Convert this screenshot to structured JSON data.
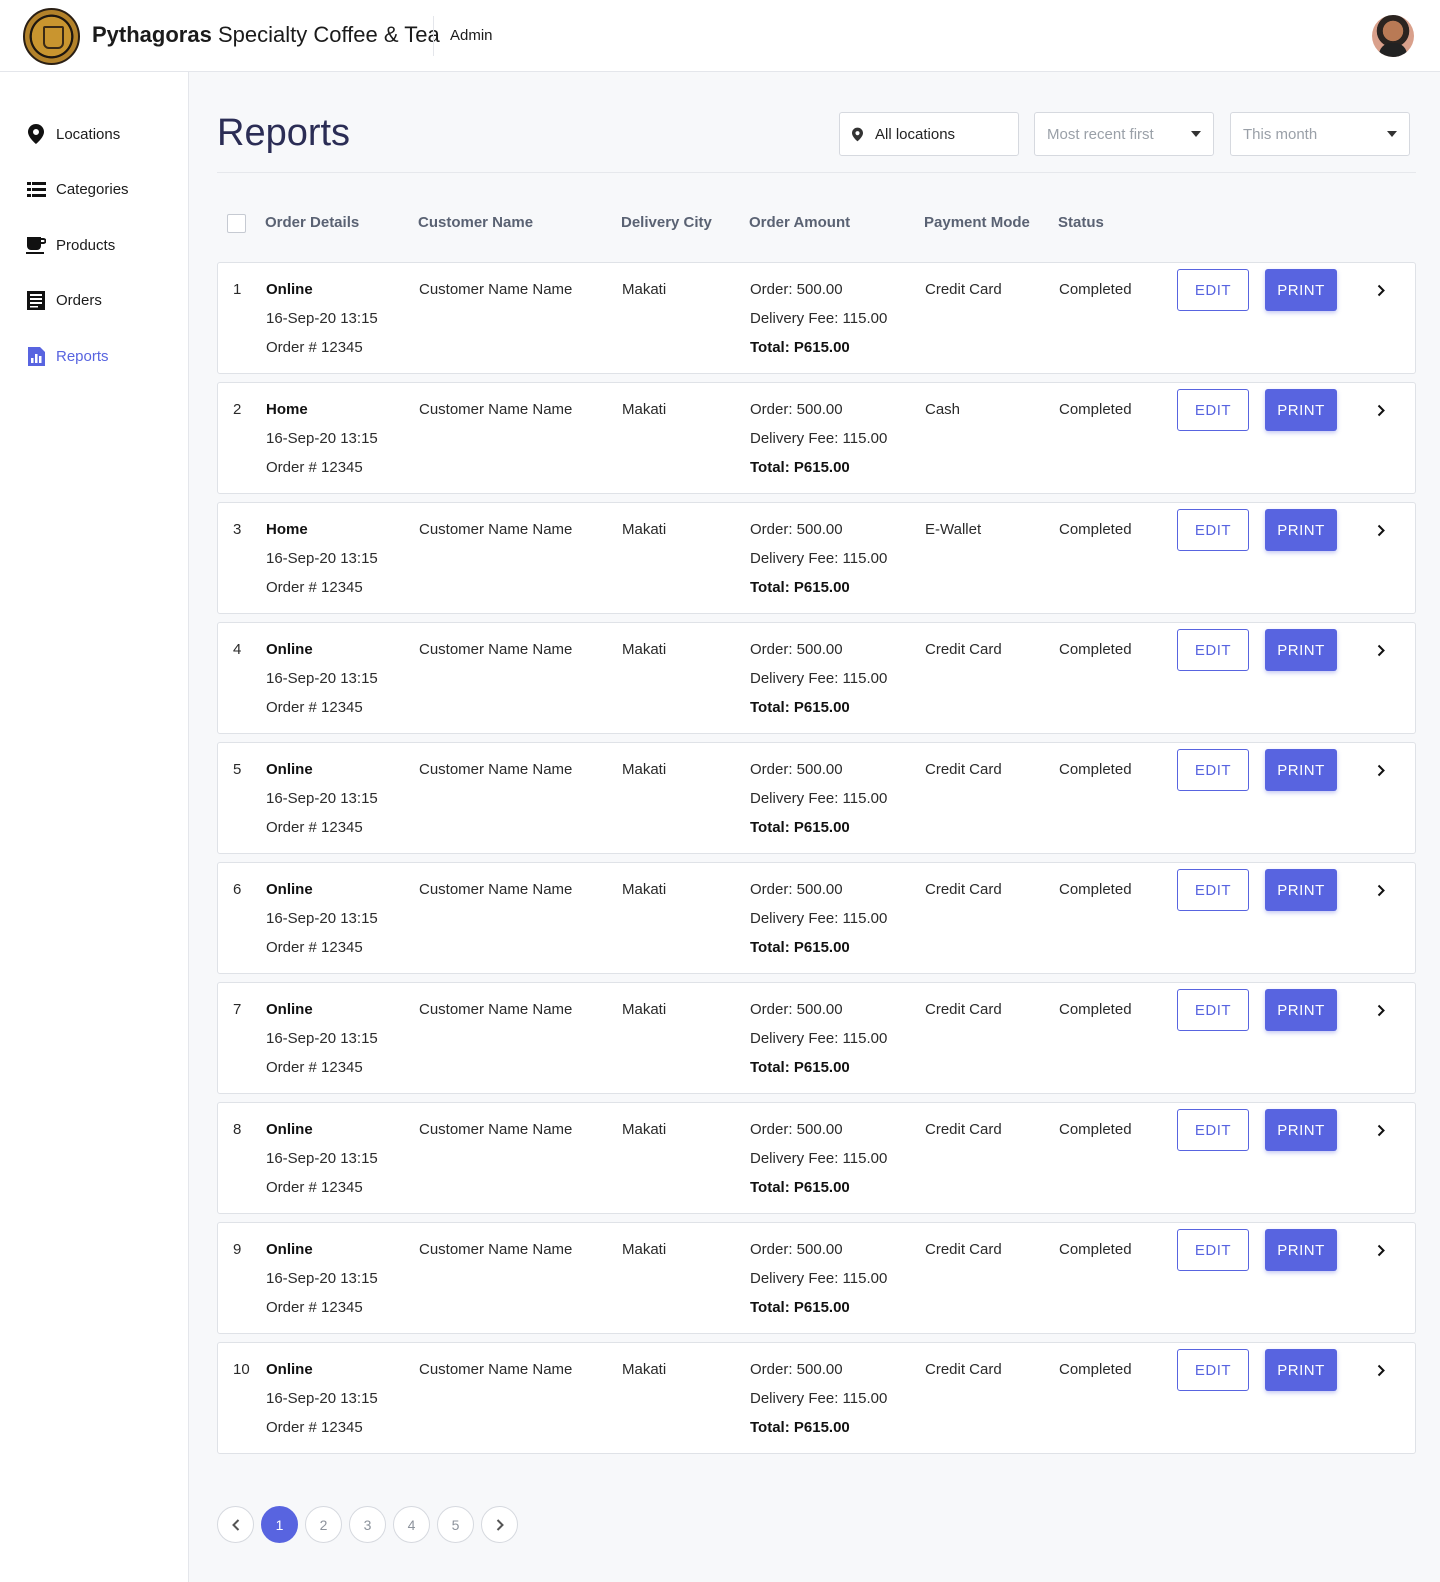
{
  "header": {
    "brand_bold": "Pythagoras",
    "brand_rest": " Specialty Coffee & Tea",
    "role": "Admin"
  },
  "sidebar": {
    "items": [
      {
        "label": "Locations",
        "icon": "map-pin-icon"
      },
      {
        "label": "Categories",
        "icon": "list-icon"
      },
      {
        "label": "Products",
        "icon": "coffee-cup-icon"
      },
      {
        "label": "Orders",
        "icon": "orders-list-icon"
      },
      {
        "label": "Reports",
        "icon": "bar-chart-icon"
      }
    ],
    "active": "Reports"
  },
  "page": {
    "title": "Reports"
  },
  "filters": {
    "location": "All locations",
    "sort": "Most recent first",
    "period": "This month"
  },
  "table": {
    "headers": {
      "order_details": "Order Details",
      "customer_name": "Customer Name",
      "delivery_city": "Delivery City",
      "order_amount": "Order Amount",
      "payment_mode": "Payment Mode",
      "status": "Status"
    },
    "edit_label": "EDIT",
    "print_label": "PRINT",
    "rows": [
      {
        "num": "1",
        "type": "Online",
        "datetime": "16-Sep-20 13:15",
        "order_no": "Order # 12345",
        "customer": "Customer Name Name",
        "city": "Makati",
        "order": "Order: 500.00",
        "fee": "Delivery Fee: 115.00",
        "total": "Total: P615.00",
        "payment": "Credit Card",
        "status": "Completed"
      },
      {
        "num": "2",
        "type": "Home",
        "datetime": "16-Sep-20 13:15",
        "order_no": "Order # 12345",
        "customer": "Customer Name Name",
        "city": "Makati",
        "order": "Order: 500.00",
        "fee": "Delivery Fee: 115.00",
        "total": "Total: P615.00",
        "payment": "Cash",
        "status": "Completed"
      },
      {
        "num": "3",
        "type": "Home",
        "datetime": "16-Sep-20 13:15",
        "order_no": "Order # 12345",
        "customer": "Customer Name Name",
        "city": "Makati",
        "order": "Order: 500.00",
        "fee": "Delivery Fee: 115.00",
        "total": "Total: P615.00",
        "payment": "E-Wallet",
        "status": "Completed"
      },
      {
        "num": "4",
        "type": "Online",
        "datetime": "16-Sep-20 13:15",
        "order_no": "Order # 12345",
        "customer": "Customer Name Name",
        "city": "Makati",
        "order": "Order: 500.00",
        "fee": "Delivery Fee: 115.00",
        "total": "Total: P615.00",
        "payment": "Credit Card",
        "status": "Completed"
      },
      {
        "num": "5",
        "type": "Online",
        "datetime": "16-Sep-20 13:15",
        "order_no": "Order # 12345",
        "customer": "Customer Name Name",
        "city": "Makati",
        "order": "Order: 500.00",
        "fee": "Delivery Fee: 115.00",
        "total": "Total: P615.00",
        "payment": "Credit Card",
        "status": "Completed"
      },
      {
        "num": "6",
        "type": "Online",
        "datetime": "16-Sep-20 13:15",
        "order_no": "Order # 12345",
        "customer": "Customer Name Name",
        "city": "Makati",
        "order": "Order: 500.00",
        "fee": "Delivery Fee: 115.00",
        "total": "Total: P615.00",
        "payment": "Credit Card",
        "status": "Completed"
      },
      {
        "num": "7",
        "type": "Online",
        "datetime": "16-Sep-20 13:15",
        "order_no": "Order # 12345",
        "customer": "Customer Name Name",
        "city": "Makati",
        "order": "Order: 500.00",
        "fee": "Delivery Fee: 115.00",
        "total": "Total: P615.00",
        "payment": "Credit Card",
        "status": "Completed"
      },
      {
        "num": "8",
        "type": "Online",
        "datetime": "16-Sep-20 13:15",
        "order_no": "Order # 12345",
        "customer": "Customer Name Name",
        "city": "Makati",
        "order": "Order: 500.00",
        "fee": "Delivery Fee: 115.00",
        "total": "Total: P615.00",
        "payment": "Credit Card",
        "status": "Completed"
      },
      {
        "num": "9",
        "type": "Online",
        "datetime": "16-Sep-20 13:15",
        "order_no": "Order # 12345",
        "customer": "Customer Name Name",
        "city": "Makati",
        "order": "Order: 500.00",
        "fee": "Delivery Fee: 115.00",
        "total": "Total: P615.00",
        "payment": "Credit Card",
        "status": "Completed"
      },
      {
        "num": "10",
        "type": "Online",
        "datetime": "16-Sep-20 13:15",
        "order_no": "Order # 12345",
        "customer": "Customer Name Name",
        "city": "Makati",
        "order": "Order: 500.00",
        "fee": "Delivery Fee: 115.00",
        "total": "Total: P615.00",
        "payment": "Credit Card",
        "status": "Completed"
      }
    ]
  },
  "pagination": {
    "pages": [
      "1",
      "2",
      "3",
      "4",
      "5"
    ],
    "current": "1"
  },
  "colors": {
    "accent": "#5864e0",
    "title": "#2b2d55",
    "header_text": "#5a6273"
  }
}
